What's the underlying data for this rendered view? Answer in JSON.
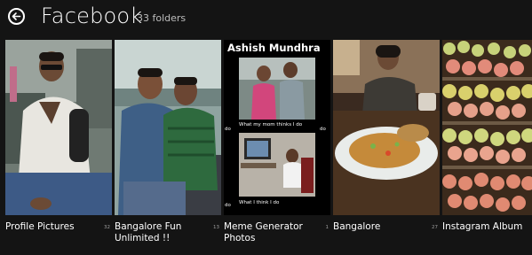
{
  "header": {
    "title": "Facebook",
    "folder_count": "33 folders",
    "back_icon": "back-arrow-icon"
  },
  "meme": {
    "title": "Ashish Mundhra",
    "caption_top": "What my mom thinks I do",
    "caption_bottom": "What I think I do",
    "side_do": "do"
  },
  "folders": [
    {
      "label": "Profile Pictures",
      "count": "32"
    },
    {
      "label": "Bangalore Fun Unlimited !!",
      "count": "13"
    },
    {
      "label": "Meme Generator Photos",
      "count": "1"
    },
    {
      "label": "Bangalore",
      "count": "27"
    },
    {
      "label": "Instagram Album",
      "count": ""
    }
  ],
  "colors": {
    "background": "#141414",
    "text": "#ffffff",
    "muted": "#bdbdbd"
  }
}
